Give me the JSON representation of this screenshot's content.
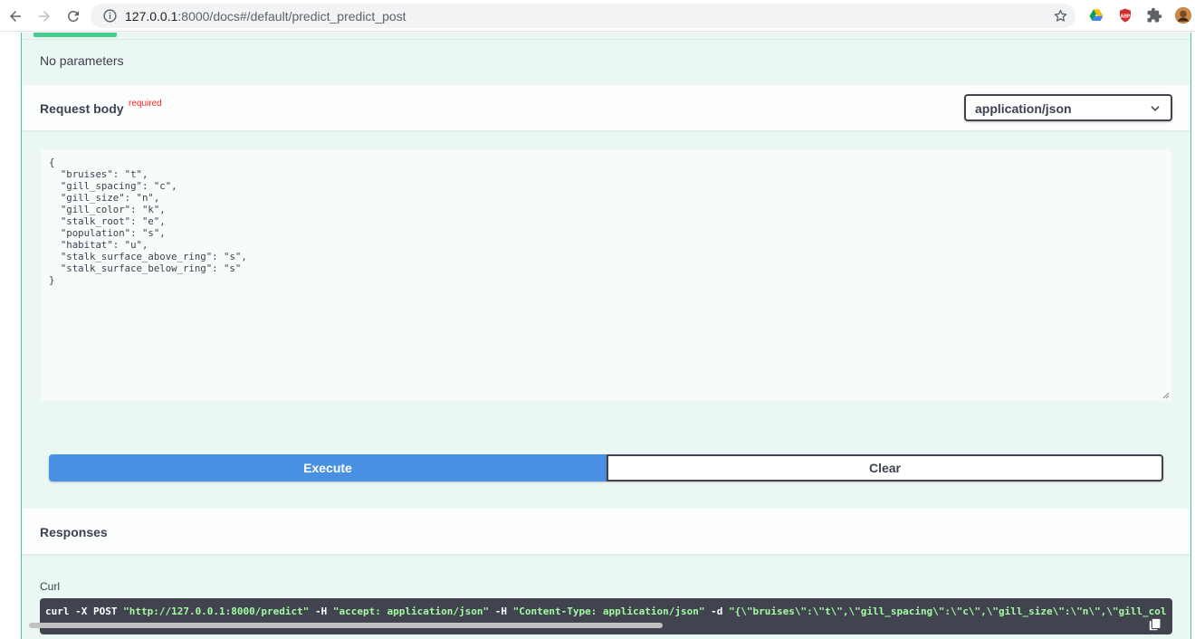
{
  "browser": {
    "url_host": "127.0.0.1",
    "url_rest": ":8000/docs#/default/predict_predict_post",
    "icons": [
      "back-icon",
      "forward-icon",
      "reload-icon",
      "info-icon",
      "star-icon",
      "google-drive-icon",
      "adblock-icon",
      "extensions-icon",
      "profile-avatar"
    ]
  },
  "parameters": {
    "empty_text": "No parameters"
  },
  "request_body": {
    "title": "Request body",
    "required_label": "required",
    "content_type": "application/json",
    "body_text": "{\n  \"bruises\": \"t\",\n  \"gill_spacing\": \"c\",\n  \"gill_size\": \"n\",\n  \"gill_color\": \"k\",\n  \"stalk_root\": \"e\",\n  \"population\": \"s\",\n  \"habitat\": \"u\",\n  \"stalk_surface_above_ring\": \"s\",\n  \"stalk_surface_below_ring\": \"s\"\n}"
  },
  "actions": {
    "execute_label": "Execute",
    "clear_label": "Clear"
  },
  "responses": {
    "title": "Responses",
    "curl_label": "Curl",
    "curl_prefix": "curl -X POST ",
    "curl_url": "\"http://127.0.0.1:8000/predict\"",
    "curl_h_flag": " -H  ",
    "curl_accept": "\"accept: application/json\"",
    "curl_h_flag2": " -H  ",
    "curl_content_type": "\"Content-Type: application/json\"",
    "curl_d_flag": " -d ",
    "curl_body": "\"{\\\"bruises\\\":\\\"t\\\",\\\"gill_spacing\\\":\\\"c\\\",\\\"gill_size\\\":\\\"n\\\",\\\"gill_col"
  },
  "colors": {
    "accent_green": "#49cc90",
    "execute_blue": "#4990e2",
    "dark": "#41444e",
    "required_red": "#ff2424"
  }
}
